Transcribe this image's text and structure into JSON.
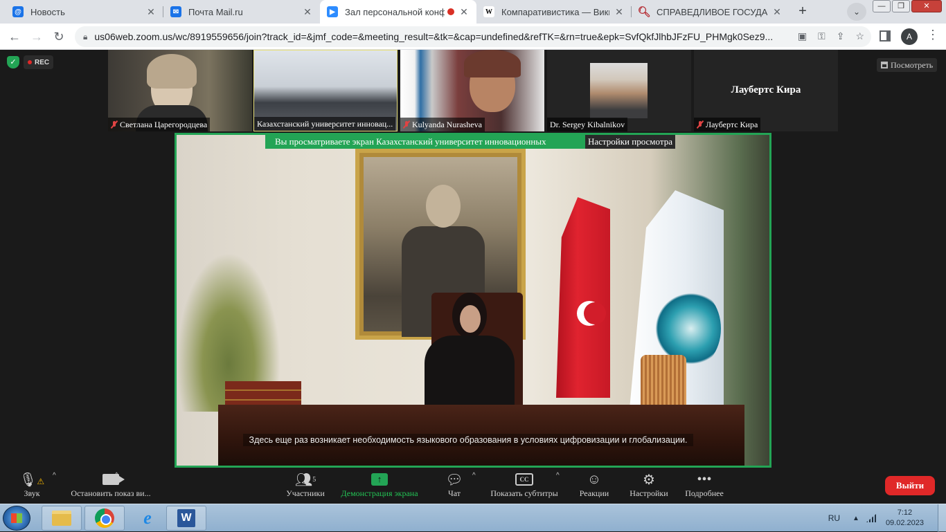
{
  "browser": {
    "tabs": [
      {
        "title": "Новость",
        "icon": "mail-at-icon",
        "color": "#1a73e8"
      },
      {
        "title": "Почта Mail.ru",
        "icon": "mail-envelope-icon",
        "color": "#1a73e8"
      },
      {
        "title": "Зал персональной конфе",
        "icon": "zoom-icon",
        "color": "#2d8cff",
        "active": true,
        "recording": true
      },
      {
        "title": "Компаративистика — Википе",
        "icon": "wikipedia-icon",
        "color": "#000000"
      },
      {
        "title": "СПРАВЕДЛИВОЕ ГОСУДАРСТ",
        "icon": "search-icon",
        "color": "#b3262d"
      }
    ],
    "url": "us06web.zoom.us/wc/8919559656/join?track_id=&jmf_code=&meeting_result=&tk=&cap=undefined&refTK=&rn=true&epk=SvfQkfJlhbJFzFU_PHMgk0Sez9...",
    "profile_initial": "A"
  },
  "meeting": {
    "rec_label": "REC",
    "view_label": "Посмотреть",
    "participants": [
      {
        "name": "Светлана Царегородцева",
        "muted": true
      },
      {
        "name": "Казахстанский университет инновац...",
        "muted": false
      },
      {
        "name": "Kulyanda Nurasheva",
        "muted": true
      },
      {
        "name": "Dr. Sergey Kibalnikov",
        "muted": false
      },
      {
        "name": "Лаубертс Кира",
        "muted": true,
        "display_name": "Лаубертс Кира"
      }
    ],
    "share_banner": "Вы просматриваете экран Казахстанский университет инновационных",
    "share_settings": "Настройки просмотра",
    "caption": "Здесь еще раз возникает необходимость языкового образования в условиях цифровизации и глобализации."
  },
  "controls": {
    "audio": "Звук",
    "video": "Остановить показ ви...",
    "participants": "Участники",
    "participants_count": "5",
    "share": "Демонстрация экрана",
    "chat": "Чат",
    "subtitles": "Показать субтитры",
    "subtitles_icon": "CC",
    "reactions": "Реакции",
    "settings": "Настройки",
    "more": "Подробнее",
    "leave": "Выйти"
  },
  "taskbar": {
    "lang": "RU",
    "time": "7:12",
    "date": "09.02.2023"
  },
  "colors": {
    "zoom_green": "#23a455",
    "leave_red": "#e02828"
  }
}
